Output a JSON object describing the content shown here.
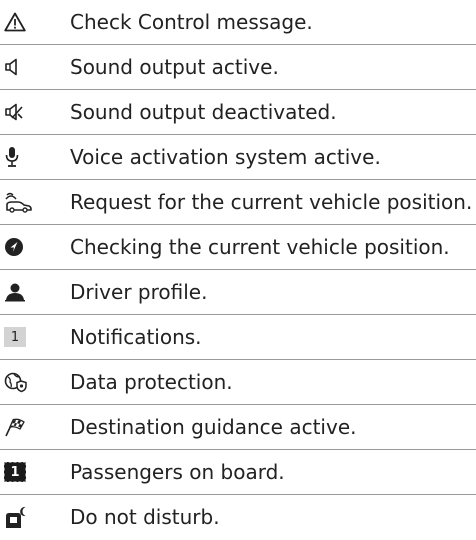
{
  "rows": [
    {
      "icon": "warning-triangle-icon",
      "label": "Check Control message."
    },
    {
      "icon": "speaker-icon",
      "label": "Sound output active."
    },
    {
      "icon": "speaker-muted-icon",
      "label": "Sound output deactivated."
    },
    {
      "icon": "microphone-icon",
      "label": "Voice activation system active."
    },
    {
      "icon": "car-request-position-icon",
      "label": "Request for the current vehicle position."
    },
    {
      "icon": "compass-navigation-icon",
      "label": "Checking the current vehicle position."
    },
    {
      "icon": "driver-profile-icon",
      "label": "Driver profile."
    },
    {
      "icon": "notification-count-icon",
      "label": "Notifications.",
      "badge": "1"
    },
    {
      "icon": "data-protection-icon",
      "label": "Data protection."
    },
    {
      "icon": "checkered-flag-icon",
      "label": "Destination guidance active."
    },
    {
      "icon": "passengers-count-icon",
      "label": "Passengers on board.",
      "badge": "1"
    },
    {
      "icon": "do-not-disturb-icon",
      "label": "Do not disturb."
    }
  ]
}
